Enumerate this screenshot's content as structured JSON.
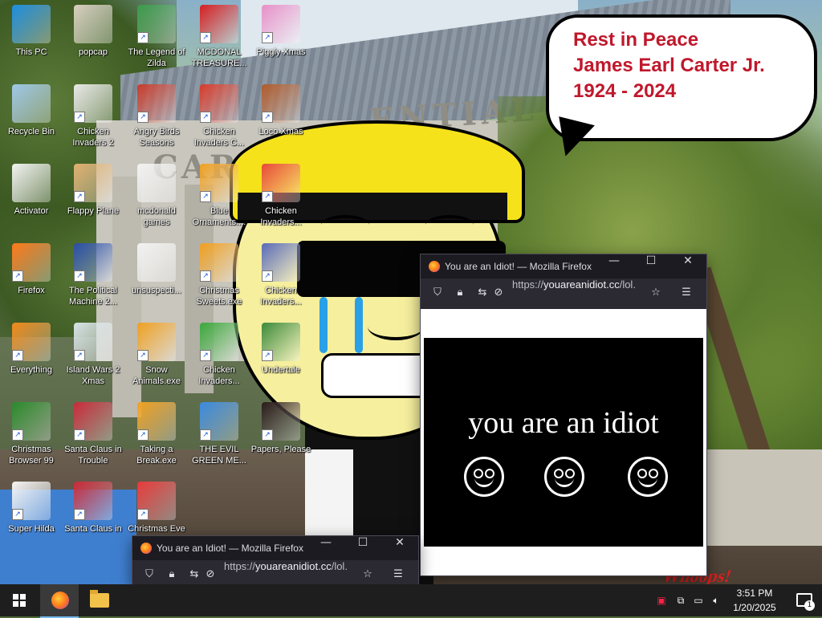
{
  "wallpaper": {
    "sign_text_1": "ENTIAL",
    "sign_text_2": "CARTE",
    "bubble_lines": [
      "Rest in Peace",
      "James Earl Carter Jr.",
      "1924 - 2024"
    ],
    "bubble_color": "#c0182c",
    "corner_mark": "Whoops!"
  },
  "desktop": {
    "icons": [
      {
        "label": "This PC",
        "icon": "computer-icon",
        "color": "#1e8fe0",
        "shortcut": false
      },
      {
        "label": "popcap",
        "icon": "folder-icon",
        "color": "#d8d0c0",
        "shortcut": false
      },
      {
        "label": "The Legend of Zilda",
        "icon": "game-icon",
        "color": "#3a9a4a",
        "shortcut": true
      },
      {
        "label": "MCDONAL TREASURE...",
        "icon": "mcdonalds-icon",
        "color": "#d81e1e",
        "shortcut": true
      },
      {
        "label": "Piggly Xmas",
        "icon": "pig-icon",
        "color": "#e890c8",
        "shortcut": true
      },
      {
        "label": "Recycle Bin",
        "icon": "recycle-bin-icon",
        "color": "#9fc8e8",
        "shortcut": false
      },
      {
        "label": "Chicken Invaders 2",
        "icon": "chicken-icon",
        "color": "#e8e8e8",
        "shortcut": true
      },
      {
        "label": "Angry Birds Seasons",
        "icon": "angry-bird-icon",
        "color": "#c83a2a",
        "shortcut": true
      },
      {
        "label": "Chicken Invaders C...",
        "icon": "chicken-icon",
        "color": "#d83a2a",
        "shortcut": true
      },
      {
        "label": "Loco Xmas",
        "icon": "bear-icon",
        "color": "#b05a2a",
        "shortcut": true
      },
      {
        "label": "Activator",
        "icon": "file-icon",
        "color": "#f2f2f2",
        "shortcut": false
      },
      {
        "label": "Flappy Plane",
        "icon": "plane-icon",
        "color": "#e0b070",
        "shortcut": true
      },
      {
        "label": "mcdonald games",
        "icon": "file-icon",
        "color": "#f2f2f2",
        "shortcut": false
      },
      {
        "label": "Blue Ornaments....",
        "icon": "butterfly-icon",
        "color": "#f0a020",
        "shortcut": true
      },
      {
        "label": "Chicken Invaders...",
        "icon": "chicken-icon",
        "color": "#e84a3a",
        "shortcut": true
      },
      {
        "label": "Firefox",
        "icon": "firefox-icon",
        "color": "#ff7a1a",
        "shortcut": true
      },
      {
        "label": "The Political Machine 2...",
        "icon": "badge-2020-icon",
        "color": "#2a4ea8",
        "shortcut": true
      },
      {
        "label": "unsuspecti...",
        "icon": "file-icon",
        "color": "#f2f2f2",
        "shortcut": false
      },
      {
        "label": "Christmas Sweets.exe",
        "icon": "butterfly-icon",
        "color": "#f0a020",
        "shortcut": true
      },
      {
        "label": "Chicken Invaders...",
        "icon": "chicken-icon",
        "color": "#5a6ab8",
        "shortcut": true
      },
      {
        "label": "Everything",
        "icon": "magnifier-icon",
        "color": "#f08a1a",
        "shortcut": true
      },
      {
        "label": "Island Wars 2 Xmas",
        "icon": "ships-icon",
        "color": "#d8e4e8",
        "shortcut": true
      },
      {
        "label": "Snow Animals.exe",
        "icon": "butterfly-icon",
        "color": "#f0a020",
        "shortcut": true
      },
      {
        "label": "Chicken Invaders...",
        "icon": "chicken-icon",
        "color": "#3aa83a",
        "shortcut": true
      },
      {
        "label": "Undertale",
        "icon": "undertale-icon",
        "color": "#3a8a3a",
        "shortcut": true
      },
      {
        "label": "Christmas Browser 99",
        "icon": "tree-99-icon",
        "color": "#2a8a2a",
        "shortcut": true
      },
      {
        "label": "Santa Claus in Trouble",
        "icon": "santa-icon",
        "color": "#c82a3a",
        "shortcut": true
      },
      {
        "label": "Taking a Break.exe",
        "icon": "butterfly-icon",
        "color": "#f0a020",
        "shortcut": true
      },
      {
        "label": "THE EVIL GREEN ME...",
        "icon": "people-icon",
        "color": "#3a8ae0",
        "shortcut": true
      },
      {
        "label": "Papers, Please",
        "icon": "papers-please-icon",
        "color": "#2a1a1a",
        "shortcut": true
      },
      {
        "label": "Super Hilda",
        "icon": "pixel-dog-icon",
        "color": "#f4f4f4",
        "shortcut": true
      },
      {
        "label": "Santa Claus in",
        "icon": "santa-icon",
        "color": "#c82a3a",
        "shortcut": true
      },
      {
        "label": "Christmas Eve",
        "icon": "santa-face-icon",
        "color": "#e83a3a",
        "shortcut": true
      }
    ]
  },
  "window_main": {
    "title": "You are an Idiot! — Mozilla Firefox",
    "url_prefix": "https://",
    "url_host": "youareanidiot.cc",
    "url_path": "/lol.",
    "page_text": "you are an idiot",
    "controls": {
      "minimize": "—",
      "maximize": "☐",
      "close": "✕"
    }
  },
  "window_small": {
    "title": "You are an Idiot! — Mozilla Firefox",
    "url_prefix": "https://",
    "url_host": "youareanidiot.cc",
    "url_path": "/lol.",
    "controls": {
      "minimize": "—",
      "maximize": "☐",
      "close": "✕"
    }
  },
  "taskbar": {
    "time": "3:51 PM",
    "date": "1/20/2025",
    "notification_count": "1",
    "tray_icons": [
      "security-alert-icon",
      "network-share-icon",
      "network-icon",
      "volume-muted-icon"
    ]
  }
}
